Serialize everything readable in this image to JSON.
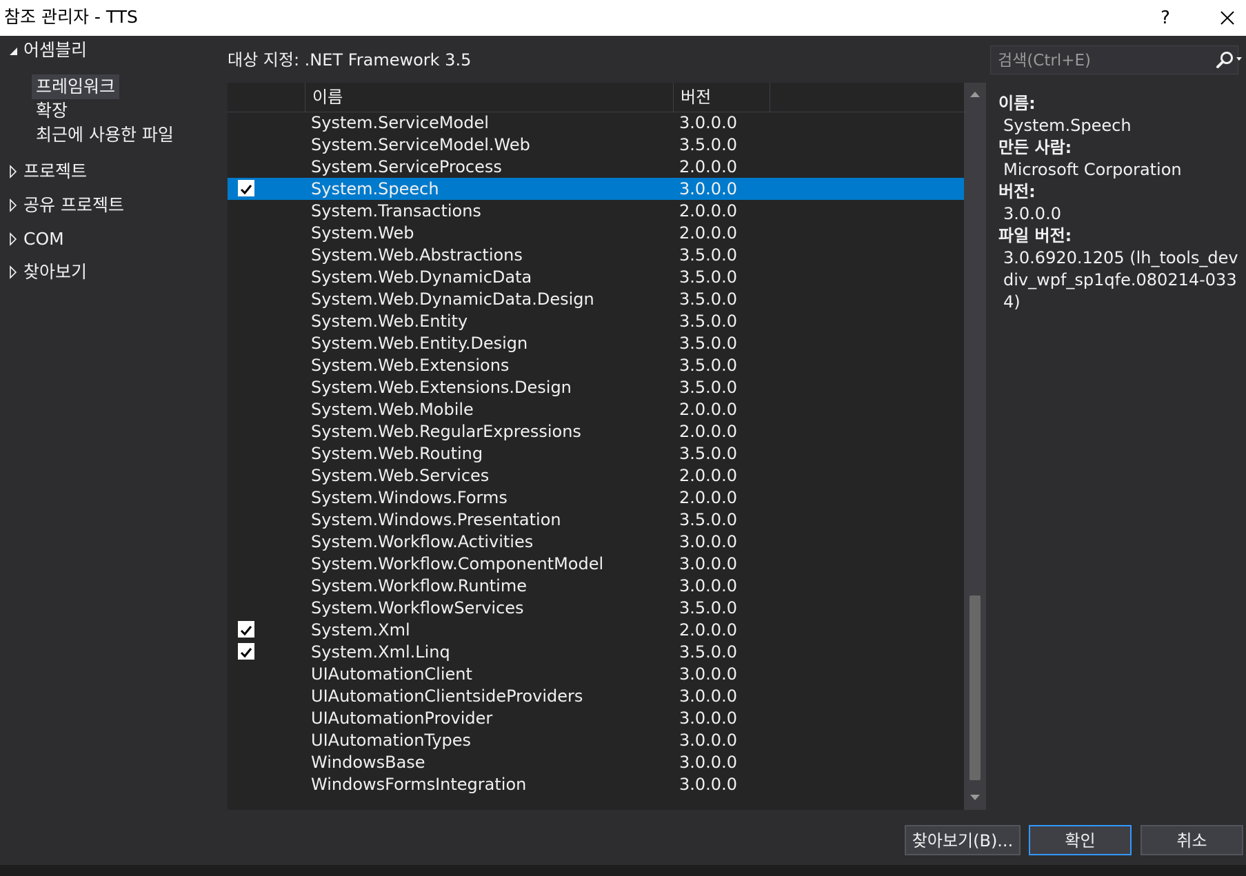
{
  "window": {
    "title": "참조 관리자 - TTS",
    "help_label": "?"
  },
  "sidebar": {
    "sections": [
      {
        "label": "어셈블리",
        "expanded": true
      },
      {
        "label": "프로젝트",
        "expanded": false
      },
      {
        "label": "공유 프로젝트",
        "expanded": false
      },
      {
        "label": "COM",
        "expanded": false
      },
      {
        "label": "찾아보기",
        "expanded": false
      }
    ],
    "assembly_items": [
      {
        "label": "프레임워크",
        "selected": true
      },
      {
        "label": "확장",
        "selected": false
      },
      {
        "label": "최근에 사용한 파일",
        "selected": false
      }
    ]
  },
  "header": {
    "target": "대상 지정: .NET Framework 3.5"
  },
  "search": {
    "placeholder": "검색(Ctrl+E)"
  },
  "list": {
    "columns": {
      "name": "이름",
      "version": "버전"
    },
    "rows": [
      {
        "name": "System.ServiceModel",
        "version": "3.0.0.0",
        "checked": false,
        "selected": false
      },
      {
        "name": "System.ServiceModel.Web",
        "version": "3.5.0.0",
        "checked": false,
        "selected": false
      },
      {
        "name": "System.ServiceProcess",
        "version": "2.0.0.0",
        "checked": false,
        "selected": false
      },
      {
        "name": "System.Speech",
        "version": "3.0.0.0",
        "checked": true,
        "selected": true
      },
      {
        "name": "System.Transactions",
        "version": "2.0.0.0",
        "checked": false,
        "selected": false
      },
      {
        "name": "System.Web",
        "version": "2.0.0.0",
        "checked": false,
        "selected": false
      },
      {
        "name": "System.Web.Abstractions",
        "version": "3.5.0.0",
        "checked": false,
        "selected": false
      },
      {
        "name": "System.Web.DynamicData",
        "version": "3.5.0.0",
        "checked": false,
        "selected": false
      },
      {
        "name": "System.Web.DynamicData.Design",
        "version": "3.5.0.0",
        "checked": false,
        "selected": false
      },
      {
        "name": "System.Web.Entity",
        "version": "3.5.0.0",
        "checked": false,
        "selected": false
      },
      {
        "name": "System.Web.Entity.Design",
        "version": "3.5.0.0",
        "checked": false,
        "selected": false
      },
      {
        "name": "System.Web.Extensions",
        "version": "3.5.0.0",
        "checked": false,
        "selected": false
      },
      {
        "name": "System.Web.Extensions.Design",
        "version": "3.5.0.0",
        "checked": false,
        "selected": false
      },
      {
        "name": "System.Web.Mobile",
        "version": "2.0.0.0",
        "checked": false,
        "selected": false
      },
      {
        "name": "System.Web.RegularExpressions",
        "version": "2.0.0.0",
        "checked": false,
        "selected": false
      },
      {
        "name": "System.Web.Routing",
        "version": "3.5.0.0",
        "checked": false,
        "selected": false
      },
      {
        "name": "System.Web.Services",
        "version": "2.0.0.0",
        "checked": false,
        "selected": false
      },
      {
        "name": "System.Windows.Forms",
        "version": "2.0.0.0",
        "checked": false,
        "selected": false
      },
      {
        "name": "System.Windows.Presentation",
        "version": "3.5.0.0",
        "checked": false,
        "selected": false
      },
      {
        "name": "System.Workflow.Activities",
        "version": "3.0.0.0",
        "checked": false,
        "selected": false
      },
      {
        "name": "System.Workflow.ComponentModel",
        "version": "3.0.0.0",
        "checked": false,
        "selected": false
      },
      {
        "name": "System.Workflow.Runtime",
        "version": "3.0.0.0",
        "checked": false,
        "selected": false
      },
      {
        "name": "System.WorkflowServices",
        "version": "3.5.0.0",
        "checked": false,
        "selected": false
      },
      {
        "name": "System.Xml",
        "version": "2.0.0.0",
        "checked": true,
        "selected": false
      },
      {
        "name": "System.Xml.Linq",
        "version": "3.5.0.0",
        "checked": true,
        "selected": false
      },
      {
        "name": "UIAutomationClient",
        "version": "3.0.0.0",
        "checked": false,
        "selected": false
      },
      {
        "name": "UIAutomationClientsideProviders",
        "version": "3.0.0.0",
        "checked": false,
        "selected": false
      },
      {
        "name": "UIAutomationProvider",
        "version": "3.0.0.0",
        "checked": false,
        "selected": false
      },
      {
        "name": "UIAutomationTypes",
        "version": "3.0.0.0",
        "checked": false,
        "selected": false
      },
      {
        "name": "WindowsBase",
        "version": "3.0.0.0",
        "checked": false,
        "selected": false
      },
      {
        "name": "WindowsFormsIntegration",
        "version": "3.0.0.0",
        "checked": false,
        "selected": false
      }
    ]
  },
  "details": {
    "name_label": "이름:",
    "name": "System.Speech",
    "author_label": "만든 사람:",
    "author": "Microsoft Corporation",
    "version_label": "버전:",
    "version": "3.0.0.0",
    "file_version_label": "파일 버전:",
    "file_version": "3.0.6920.1205 (lh_tools_devdiv_wpf_sp1qfe.080214-0334)"
  },
  "buttons": {
    "browse": "찾아보기(B)...",
    "ok": "확인",
    "cancel": "취소"
  },
  "colors": {
    "selection": "#007acc",
    "background": "#2d2d30",
    "panel": "#252526"
  },
  "icons": {
    "search": "search-icon",
    "close": "close-icon",
    "expanded": "triangle-down-icon",
    "collapsed": "triangle-right-icon",
    "check": "checkmark-icon"
  }
}
